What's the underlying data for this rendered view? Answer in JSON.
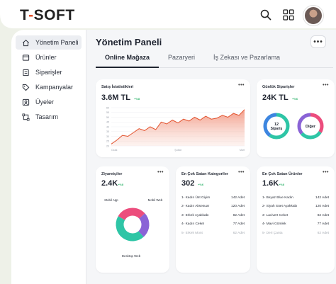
{
  "brand": {
    "logo_prefix": "T",
    "logo_dash": "-",
    "logo_rest": "SOFT"
  },
  "colors": {
    "accent": "#e3522d",
    "green": "#2fb36b",
    "teal": "#2ec5a6",
    "blue": "#3d86e0",
    "pink": "#ec4d7d",
    "violet": "#8a63d6"
  },
  "header": {
    "icons": [
      "search-icon",
      "grid-icon"
    ]
  },
  "sidebar": {
    "items": [
      {
        "label": "Yönetim Paneli",
        "icon": "home-icon",
        "active": true
      },
      {
        "label": "Ürünler",
        "icon": "box-icon",
        "active": false
      },
      {
        "label": "Siparişler",
        "icon": "receipt-icon",
        "active": false
      },
      {
        "label": "Kampanyalar",
        "icon": "tag-icon",
        "active": false
      },
      {
        "label": "Üyeler",
        "icon": "users-icon",
        "active": false
      },
      {
        "label": "Tasarım",
        "icon": "design-icon",
        "active": false
      }
    ]
  },
  "main": {
    "title": "Yönetim Paneli",
    "more": "•••",
    "tabs": [
      {
        "label": "Online Mağaza",
        "active": true
      },
      {
        "label": "Pazaryeri",
        "active": false
      },
      {
        "label": "İş Zekası ve Pazarlama",
        "active": false
      }
    ]
  },
  "cards": {
    "sales": {
      "title": "Satış İstatistikleri",
      "value": "3.6M TL",
      "change": "+%8",
      "dots": "•••"
    },
    "orders": {
      "title": "Günlük Siparişler",
      "value": "24K TL",
      "change": "+%6",
      "dots": "•••",
      "donut1_label": [
        "12",
        "Sipariş"
      ],
      "donut2_label": "Diğer"
    },
    "visitors": {
      "title": "Ziyaretçiler",
      "value": "2.4K",
      "change": "+%8",
      "dots": "•••",
      "labels": [
        "Mobil App",
        "Mobil Web",
        "Desktop Web"
      ]
    },
    "categories": {
      "title": "En Çok Satan Kategoriler",
      "value": "302",
      "change": "+%6",
      "dots": "•••",
      "rows": [
        {
          "name": "1- Kadın Üst Giyim",
          "qty": "142 Adet"
        },
        {
          "name": "2- Kadın Aksesuar",
          "qty": "120 Adet"
        },
        {
          "name": "3- Erkek Ayakkabı",
          "qty": "82 Adet"
        },
        {
          "name": "4- Kadın Ceket",
          "qty": "77 Adet"
        },
        {
          "name": "5- Erkek Mont",
          "qty": "62 Adet"
        }
      ]
    },
    "products": {
      "title": "En Çok Satan Ürünler",
      "value": "1.6K",
      "change": "+%8",
      "dots": "•••",
      "rows": [
        {
          "name": "1- Beyaz Blue Kadın",
          "qty": "142 Adet"
        },
        {
          "name": "2- Siyah Süet Ayakkabı",
          "qty": "120 Adet"
        },
        {
          "name": "3- Lacivert Ceket",
          "qty": "82 Adet"
        },
        {
          "name": "4- Mavi Gömlek",
          "qty": "77 Adet"
        },
        {
          "name": "5- Deri Çanta",
          "qty": "62 Adet"
        }
      ]
    }
  },
  "chart_data": [
    {
      "type": "area",
      "title": "Satış İstatistikleri",
      "x": [
        "Ocak",
        "Şubat",
        "Mart"
      ],
      "y_ticks": [
        "60",
        "55",
        "50",
        "45",
        "40",
        "35",
        "30",
        "25",
        "20"
      ],
      "values": [
        22,
        26,
        31,
        30,
        34,
        38,
        36,
        40,
        37,
        45,
        43,
        47,
        44,
        48,
        46,
        50,
        47,
        51,
        48,
        49,
        52,
        50,
        54,
        52,
        58
      ],
      "ylim": [
        20,
        60
      ],
      "grid": true
    },
    {
      "type": "pie",
      "title": "Ziyaretçiler",
      "labels": [
        "Mobil App",
        "Mobil Web",
        "Desktop Web"
      ],
      "values": [
        30,
        25,
        45
      ]
    }
  ]
}
